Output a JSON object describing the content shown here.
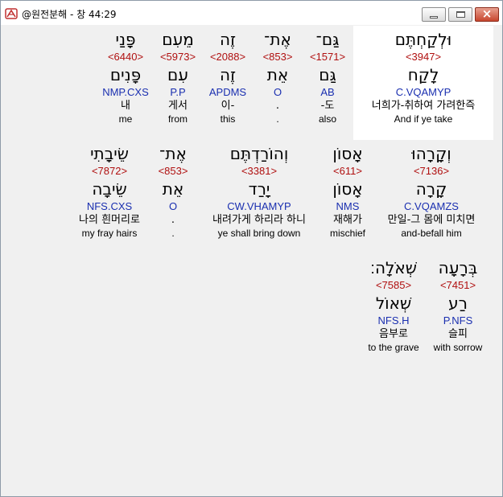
{
  "window": {
    "title": "@원전분해 - 창 44:29",
    "icon": "bible-app-icon",
    "controls": {
      "minimize": "minimize-icon",
      "maximize": "maximize-icon",
      "close": "close-icon"
    }
  },
  "colors": {
    "strong_number": "#b01010",
    "morphology": "#1a2fb0",
    "text": "#000000",
    "background": "#f0f0f0",
    "selected_background": "#ffffff"
  },
  "words": [
    {
      "hebrew": "וּלְקַחְתֶּם",
      "strong": "<3947>",
      "lemma": "לָקַח",
      "morph": "C.VQAMYP",
      "korean": "너희가-취하여 가려한즉",
      "english": "And if ye take"
    },
    {
      "hebrew": "גַּם־",
      "strong": "<1571>",
      "lemma": "גַּם",
      "morph": "AB",
      "korean": "-도",
      "english": "also"
    },
    {
      "hebrew": "אֶת־",
      "strong": "<853>",
      "lemma": "אֵת",
      "morph": "O",
      "korean": ".",
      "english": "."
    },
    {
      "hebrew": "זֶה",
      "strong": "<2088>",
      "lemma": "זֶה",
      "morph": "APDMS",
      "korean": "이-",
      "english": "this"
    },
    {
      "hebrew": "מֵעִם",
      "strong": "<5973>",
      "lemma": "עִם",
      "morph": "P.P",
      "korean": "게서",
      "english": "from"
    },
    {
      "hebrew": "פָּנַי",
      "strong": "<6440>",
      "lemma": "פָּנִים",
      "morph": "NMP.CXS",
      "korean": "내",
      "english": "me"
    },
    {
      "hebrew": "וְקָרָהוּ",
      "strong": "<7136>",
      "lemma": "קָרָה",
      "morph": "C.VQAMZS",
      "korean": "만일-그 몸에 미치면",
      "english": "and-befall him"
    },
    {
      "hebrew": "אָסוֹן",
      "strong": "<611>",
      "lemma": "אָסוֹן",
      "morph": "NMS",
      "korean": "재해가",
      "english": "mischief"
    },
    {
      "hebrew": "וְהוֹרַדְתֶּם",
      "strong": "<3381>",
      "lemma": "יָרַד",
      "morph": "CW.VHAMYP",
      "korean": "내려가게 하리라 하니",
      "english": "ye shall bring down"
    },
    {
      "hebrew": "אֶת־",
      "strong": "<853>",
      "lemma": "אֵת",
      "morph": "O",
      "korean": ".",
      "english": "."
    },
    {
      "hebrew": "שֵׂיבָתִי",
      "strong": "<7872>",
      "lemma": "שֵׂיבָה",
      "morph": "NFS.CXS",
      "korean": "나의 흰머리로",
      "english": "my fray hairs"
    },
    {
      "hebrew": "בְּרָעָה",
      "strong": "<7451>",
      "lemma": "רַע",
      "morph": "P.NFS",
      "korean": "슬피",
      "english": "with sorrow"
    },
    {
      "hebrew": "שְׁאֹלָה׃",
      "strong": "<7585>",
      "lemma": "שְׁאוֹל",
      "morph": "NFS.H",
      "korean": "음부로",
      "english": "to the grave"
    }
  ]
}
